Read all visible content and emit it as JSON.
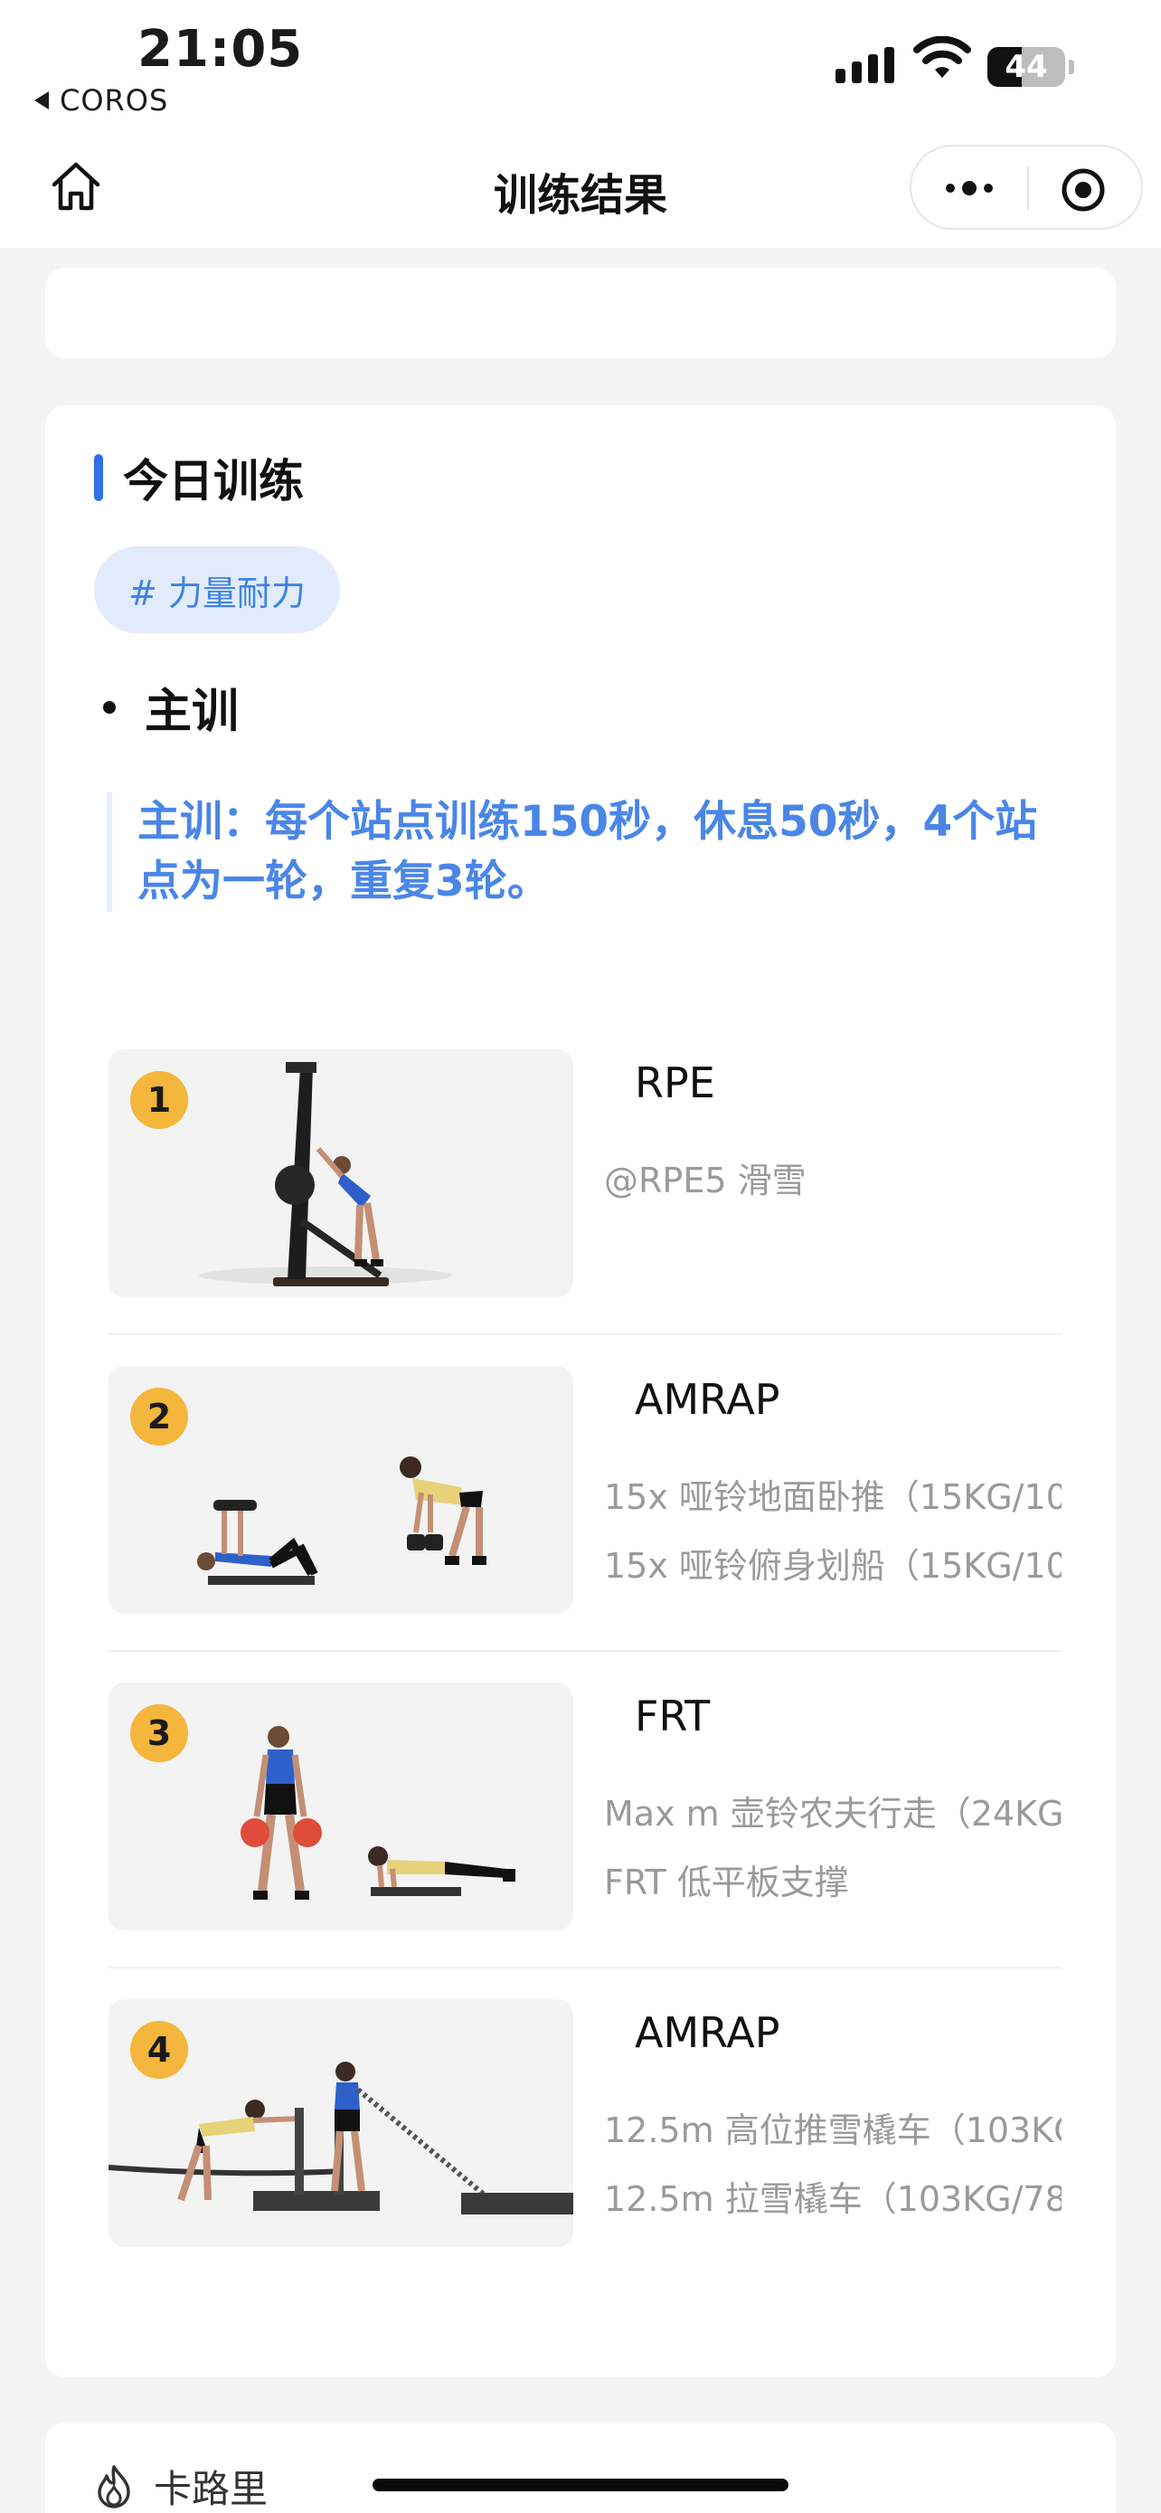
{
  "status_bar": {
    "time": "21:05",
    "back_app": "COROS",
    "battery_level": 44,
    "battery_label": "44"
  },
  "nav": {
    "title": "训练结果",
    "home_icon": "home-icon",
    "more_icon": "more-dots-icon",
    "target_icon": "target-icon"
  },
  "workout": {
    "section_title": "今日训练",
    "tag": "# 力量耐力",
    "bullet": "主训",
    "description": "主训：每个站点训练150秒，休息50秒，4个站点为一轮，重复3轮。",
    "exercises": [
      {
        "number": "1",
        "type": "RPE",
        "lines": [
          "@RPE5 滑雪"
        ]
      },
      {
        "number": "2",
        "type": "AMRAP",
        "lines": [
          "15x 哑铃地面卧推（15KG/10",
          "15x 哑铃俯身划船（15KG/10"
        ]
      },
      {
        "number": "3",
        "type": "FRT",
        "lines": [
          "Max m 壶铃农夫行走（24KG",
          "FRT 低平板支撑"
        ]
      },
      {
        "number": "4",
        "type": "AMRAP",
        "lines": [
          "12.5m 高位推雪橇车（103KG",
          "12.5m 拉雪橇车（103KG/78"
        ]
      }
    ]
  },
  "summary": {
    "calorie_label": "卡路里",
    "calorie_icon": "flame-icon"
  },
  "colors": {
    "accent_blue": "#2f6fe8",
    "quote_blue": "#4a86e8",
    "tag_bg": "#e1ebfb",
    "badge_yellow": "#f4b63c"
  }
}
